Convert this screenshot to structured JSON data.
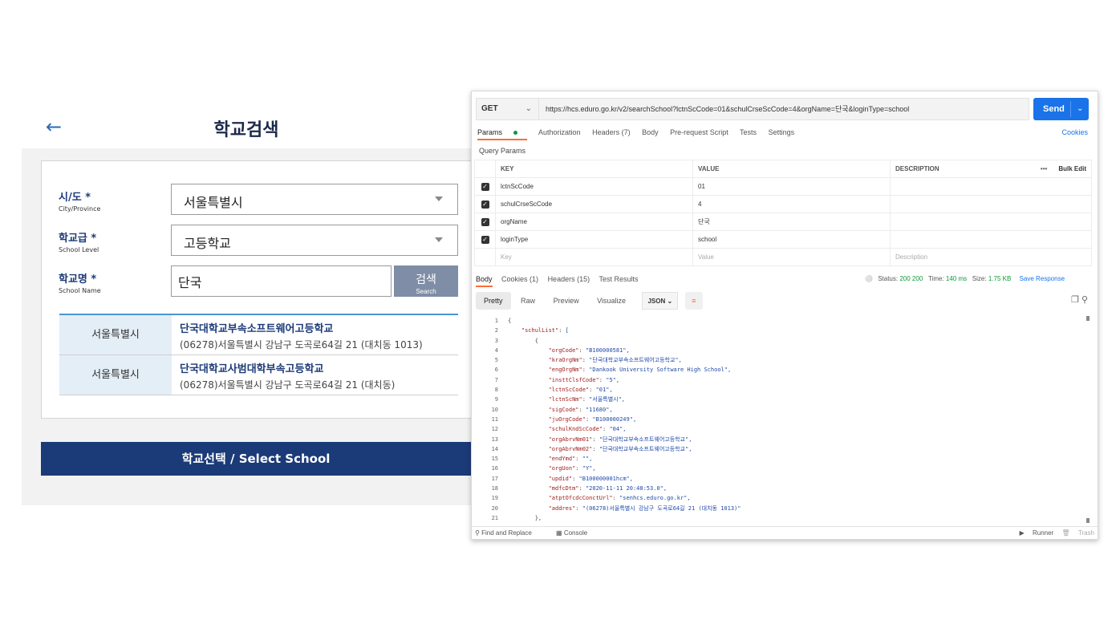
{
  "school": {
    "back_icon": "arrow-left-icon",
    "title": "학교검색",
    "fields": [
      {
        "label": "시/도 *",
        "sub": "City/Province",
        "value": "서울특별시"
      },
      {
        "label": "학교급 *",
        "sub": "School Level",
        "value": "고등학교"
      },
      {
        "label": "학교명 *",
        "sub": "School Name",
        "value": "단국"
      }
    ],
    "search": {
      "ko": "검색",
      "en": "Search"
    },
    "results": [
      {
        "region": "서울특별시",
        "name": "단국대학교부속소프트웨어고등학교",
        "addr": "(06278)서울특별시 강남구 도곡로64길 21 (대치동 1013)"
      },
      {
        "region": "서울특별시",
        "name": "단국대학교사범대학부속고등학교",
        "addr": "(06278)서울특별시 강남구 도곡로64길 21 (대치동)"
      }
    ],
    "select_button": "학교선택 / Select School",
    "colors": {
      "primary": "#1b3a78",
      "search_button": "#7f8ea6",
      "accent": "#4b95d1"
    }
  },
  "postman": {
    "method": "GET",
    "url": "https://hcs.eduro.go.kr/v2/searchSchool?lctnScCode=01&schulCrseScCode=4&orgName=단국&loginType=school",
    "send": "Send",
    "tabs": [
      "Params",
      "Authorization",
      "Headers (7)",
      "Body",
      "Pre-request Script",
      "Tests",
      "Settings"
    ],
    "cookies": "Cookies",
    "query_params_title": "Query Params",
    "table_headers": {
      "key": "KEY",
      "value": "VALUE",
      "description": "DESCRIPTION",
      "bulk": "Bulk Edit"
    },
    "params": [
      {
        "key": "lctnScCode",
        "value": "01"
      },
      {
        "key": "schulCrseScCode",
        "value": "4"
      },
      {
        "key": "orgName",
        "value": "단국"
      },
      {
        "key": "loginType",
        "value": "school"
      }
    ],
    "placeholders": {
      "key": "Key",
      "value": "Value",
      "description": "Description"
    },
    "response_tabs": [
      "Body",
      "Cookies (1)",
      "Headers (15)",
      "Test Results"
    ],
    "status": {
      "status": "Status: 200",
      "status_code": "200",
      "time_label": "Time:",
      "time": "140 ms",
      "size_label": "Size:",
      "size": "1.75 KB",
      "save": "Save Response"
    },
    "format_tabs": [
      "Pretty",
      "Raw",
      "Preview",
      "Visualize"
    ],
    "format": "JSON",
    "json_lines": [
      "{",
      "    \"schulList\": [",
      "        {",
      "            \"orgCode\": \"B100000581\",",
      "            \"kraOrgNm\": \"단국대학교부속소프트웨어고등학교\",",
      "            \"engOrgNm\": \"Dankook University Software High School\",",
      "            \"insttClsfCode\": \"5\",",
      "            \"lctnScCode\": \"01\",",
      "            \"lctnScNm\": \"서울특별시\",",
      "            \"sigCode\": \"11680\",",
      "            \"juOrgCode\": \"B100000249\",",
      "            \"schulKndScCode\": \"04\",",
      "            \"orgAbrvNm01\": \"단국대학교부속소프트웨어고등학교\",",
      "            \"orgAbrvNm02\": \"단국대학교부속소프트웨어고등학교\",",
      "            \"endYmd\": \"\",",
      "            \"orgUon\": \"Y\",",
      "            \"updid\": \"B100000001hcm\",",
      "            \"mdfcDtm\": \"2020-11-11 20:48:53.0\",",
      "            \"atptOfcdcConctUrl\": \"senhcs.eduro.go.kr\",",
      "            \"addres\": \"(06278)서울특별시 강남구 도곡로64길 21 (대치동 1013)\"",
      "        },"
    ],
    "bottom": {
      "find": "Find and Replace",
      "console": "Console",
      "runner": "Runner",
      "trash": "Trash"
    }
  }
}
